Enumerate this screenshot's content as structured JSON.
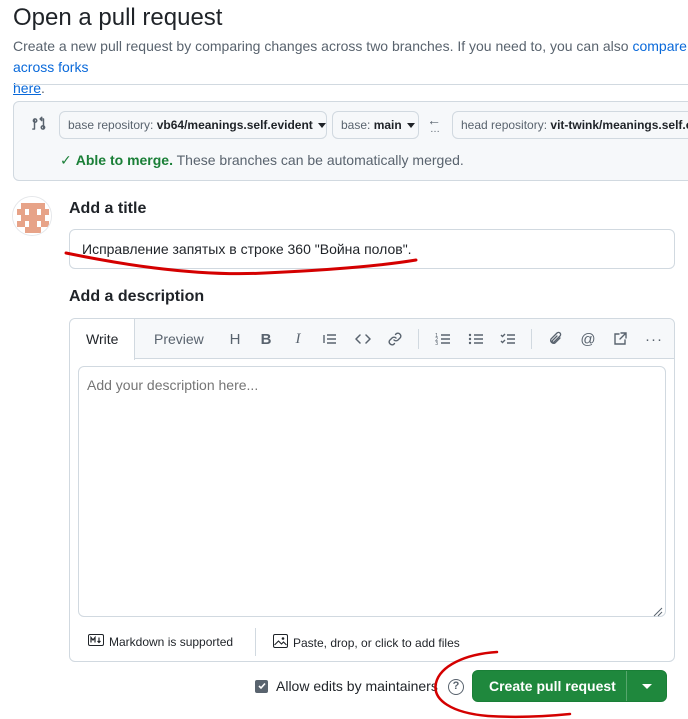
{
  "page": {
    "title": "Open a pull request",
    "subtitle_text": "Create a new pull request by comparing changes across two branches. If you need to, you can also ",
    "subtitle_link": "compare across forks",
    "subtitle_link2": "here",
    "subtitle_end": "."
  },
  "compare": {
    "base_repo_label": "base repository: ",
    "base_repo_value": "vb64/meanings.self.evident",
    "base_label": "base: ",
    "base_value": "main",
    "head_repo_label": "head repository: ",
    "head_repo_value": "vit-twink/meanings.self.evident",
    "merge_ok": "Able to merge.",
    "merge_msg": " These branches can be automatically merged."
  },
  "form": {
    "title_label": "Add a title",
    "title_value": "Исправление запятых в строке 360 \"Война полов\".",
    "description_label": "Add a description",
    "description_placeholder": "Add your description here...",
    "tabs": [
      "Write",
      "Preview"
    ],
    "markdown_note": "Markdown is supported",
    "attach_note": "Paste, drop, or click to add files"
  },
  "actions": {
    "allow_edits_label": "Allow edits by maintainers",
    "allow_edits_checked": true,
    "help": "?",
    "create_label": "Create pull request"
  },
  "colors": {
    "accent": "#0969da",
    "success": "#1a7f37",
    "button": "#1f883d",
    "annotation": "#d40000"
  }
}
